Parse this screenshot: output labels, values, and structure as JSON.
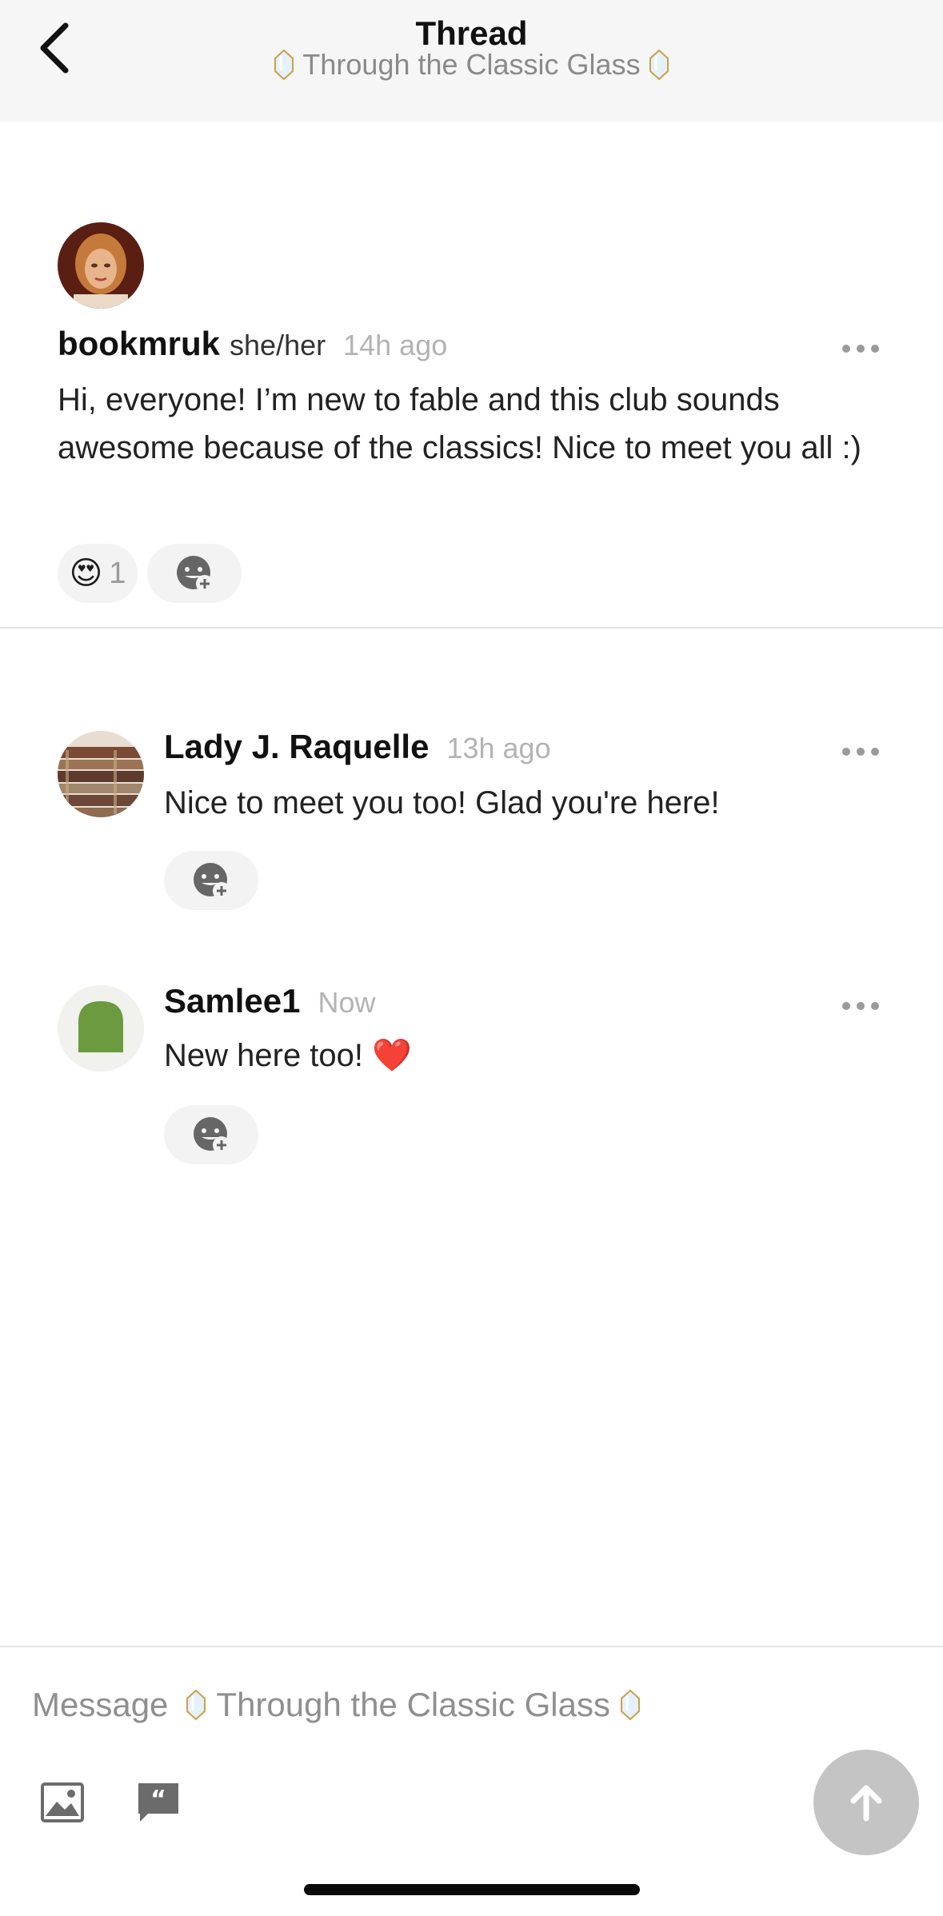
{
  "header": {
    "title": "Thread",
    "subtitle": "Through the Classic Glass",
    "back_icon": "chevron-left-icon"
  },
  "posts": [
    {
      "username": "bookmruk",
      "pronouns": "she/her",
      "time": "14h ago",
      "text": "Hi, everyone! I’m new to fable and this club sounds awesome because of the classics! Nice to meet you all :)",
      "reactions": [
        {
          "emoji": "😍",
          "count": "1"
        }
      ]
    },
    {
      "username": "Lady J. Raquelle",
      "time": "13h ago",
      "text": "Nice to meet you too! Glad you're here!"
    },
    {
      "username": "Samlee1",
      "time": "Now",
      "text": "New here too! ❤️"
    }
  ],
  "composer": {
    "placeholder_prefix": "Message",
    "placeholder_club": "Through the Classic Glass"
  },
  "colors": {
    "header_bg": "#f6f6f6",
    "send_button": "#c4c4c4",
    "timestamp": "#b3b3b3"
  }
}
